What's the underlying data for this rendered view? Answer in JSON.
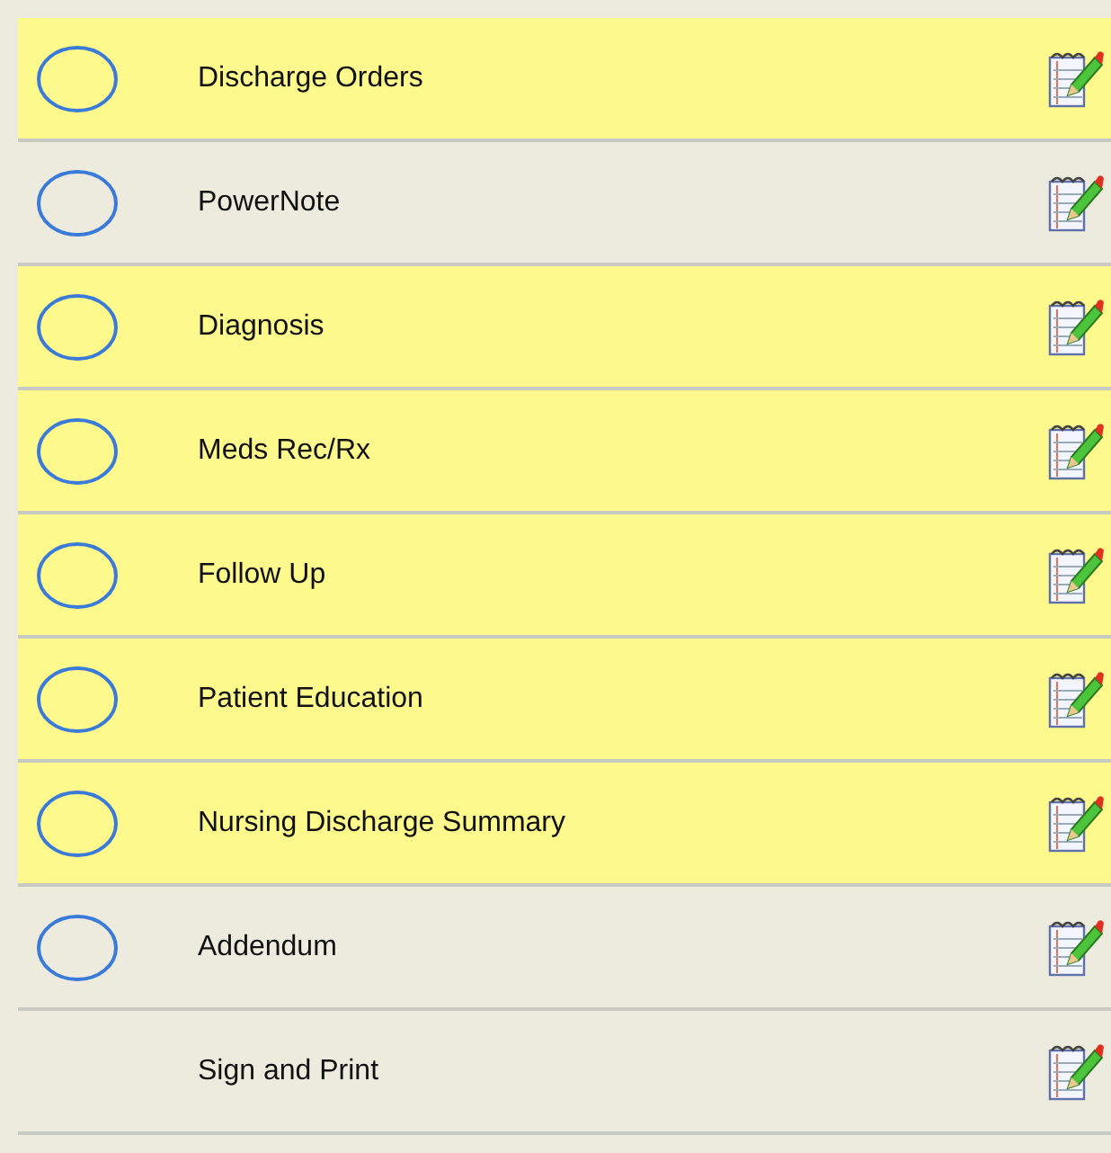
{
  "items": [
    {
      "label": "Discharge Orders",
      "highlighted": true,
      "kind": "task"
    },
    {
      "label": "PowerNote",
      "highlighted": false,
      "kind": "task"
    },
    {
      "label": "Diagnosis",
      "highlighted": true,
      "kind": "task"
    },
    {
      "label": "Meds Rec/Rx",
      "highlighted": true,
      "kind": "task"
    },
    {
      "label": "Follow Up",
      "highlighted": true,
      "kind": "task"
    },
    {
      "label": "Patient Education",
      "highlighted": true,
      "kind": "task"
    },
    {
      "label": "Nursing Discharge Summary",
      "highlighted": true,
      "kind": "task"
    },
    {
      "label": "Addendum",
      "highlighted": false,
      "kind": "task"
    },
    {
      "label": "Sign and Print",
      "highlighted": false,
      "kind": "action"
    }
  ]
}
